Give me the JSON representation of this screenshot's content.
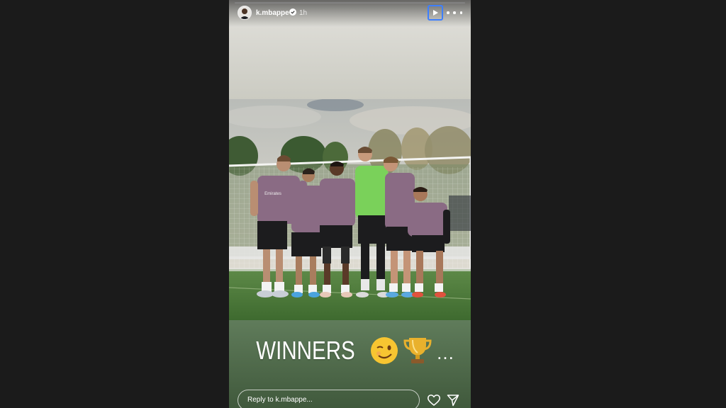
{
  "story": {
    "progress": 1.0,
    "user": {
      "username": "k.mbappe",
      "verified": true,
      "time_ago": "1h",
      "avatar_icon": "profile-avatar"
    },
    "controls": {
      "play_icon": "play-icon",
      "more_icon": "more-options-icon"
    },
    "photo": {
      "description_icon": "team-photo",
      "shirt_text": "Emirates"
    },
    "caption": {
      "text": "WINNERS",
      "emoji_wink": "😉",
      "emoji_trophy": "🏆",
      "trailing": "..."
    },
    "reply": {
      "placeholder": "Reply to k.mbappe..."
    },
    "actions": {
      "like_icon": "heart-icon",
      "share_icon": "send-icon"
    }
  },
  "colors": {
    "background": "#1b1b1b",
    "play_border": "#3d7fff",
    "shirt": "#8a6b84",
    "bib": "#7ad15a",
    "grass": "#4c7a3a"
  }
}
